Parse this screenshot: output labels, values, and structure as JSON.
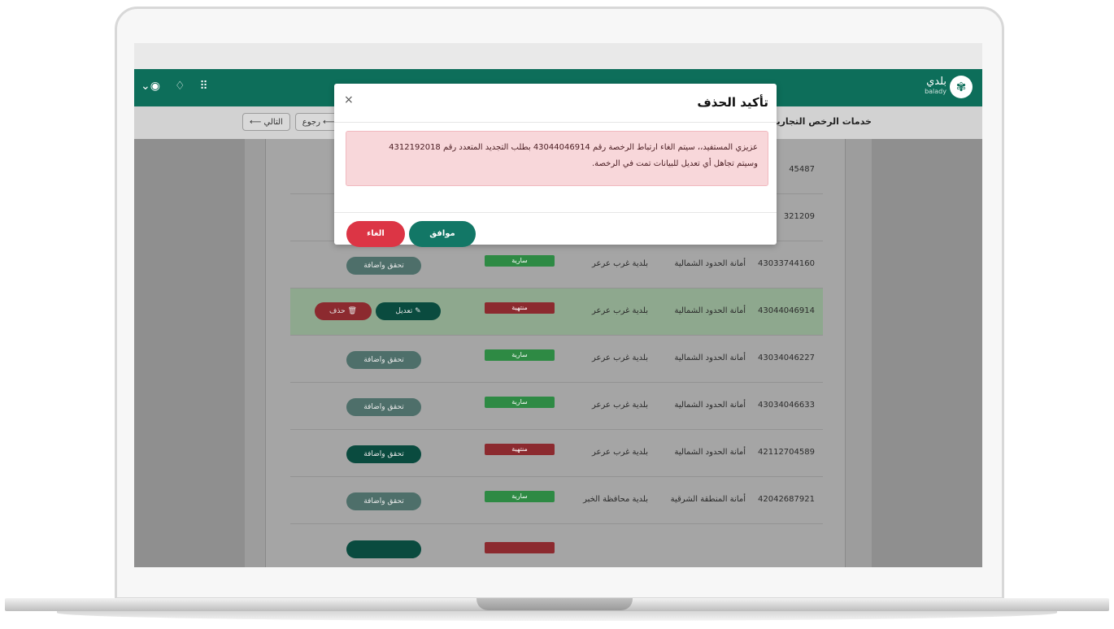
{
  "header": {
    "logo_text": "بلدي",
    "logo_sub": "balady",
    "icons": [
      "user-icon",
      "bell-icon",
      "apps-grid-icon"
    ]
  },
  "subbar": {
    "breadcrumb": "خدمات الرخص التجارية / خ",
    "back_label": "رجوع",
    "next_label": "التالي"
  },
  "table": {
    "rows": [
      {
        "number": "45487",
        "amana": "",
        "baladiya": "",
        "status": "",
        "action": ""
      },
      {
        "number": "321209",
        "amana": "",
        "baladiya": "",
        "status": "",
        "action": ""
      },
      {
        "number": "43033744160",
        "amana": "أمانة الحدود الشمالية",
        "baladiya": "بلدية غرب عرعر",
        "status": "سارية",
        "action": "تحقق واضافة"
      },
      {
        "number": "43044046914",
        "amana": "أمانة الحدود الشمالية",
        "baladiya": "بلدية غرب عرعر",
        "status": "منتهية",
        "edit": "تعديل",
        "delete": "حذف"
      },
      {
        "number": "43034046227",
        "amana": "أمانة الحدود الشمالية",
        "baladiya": "بلدية غرب عرعر",
        "status": "سارية",
        "action": "تحقق واضافة"
      },
      {
        "number": "43034046633",
        "amana": "أمانة الحدود الشمالية",
        "baladiya": "بلدية غرب عرعر",
        "status": "سارية",
        "action": "تحقق واضافة"
      },
      {
        "number": "42112704589",
        "amana": "أمانة الحدود الشمالية",
        "baladiya": "بلدية غرب عرعر",
        "status": "منتهية",
        "action": "تحقق واضافة"
      },
      {
        "number": "42042687921",
        "amana": "أمانة المنطقة الشرقية",
        "baladiya": "بلدية محافظة الخبر",
        "status": "سارية",
        "action": "تحقق واضافة"
      }
    ]
  },
  "modal": {
    "title": "تأكيد الحذف",
    "close": "×",
    "message_line1": "عزيزي المستفيد،، سيتم الغاء ارتباط الرخصة رقم 43044046914 بطلب التجديد المتعدد رقم 4312192018",
    "message_line2": "وسيتم تجاهل أي تعديل للبيانات تمت في الرخصة.",
    "ok_label": "موافق",
    "cancel_label": "الغاء"
  },
  "colors": {
    "brand": "#0d6e5a",
    "ok": "#127766",
    "cancel": "#dc3545",
    "alert_bg": "#f8d7da"
  }
}
